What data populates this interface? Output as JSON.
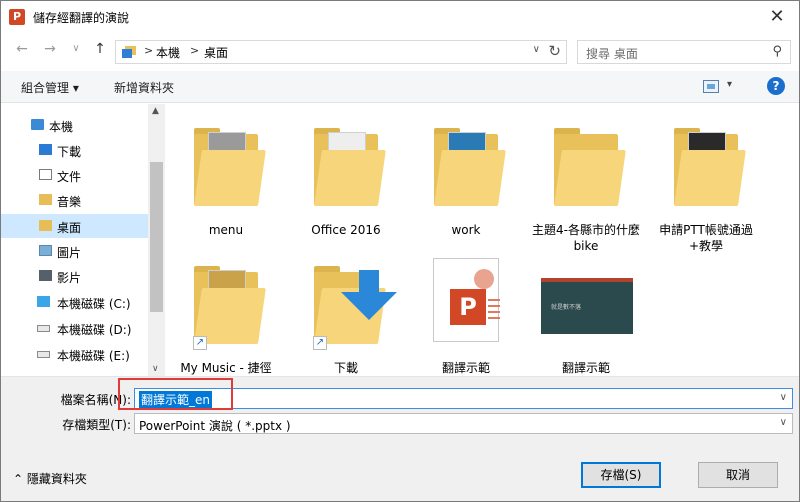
{
  "window": {
    "title": "儲存經翻譯的演說",
    "app_icon_letter": "P",
    "close_glyph": "✕"
  },
  "nav": {
    "back_glyph": "←",
    "forward_glyph": "→",
    "recent_glyph": "∨",
    "up_glyph": "↑",
    "breadcrumb": [
      "本機",
      "桌面"
    ],
    "crumb_sep": ">",
    "dropdown_glyph": "∨",
    "refresh_glyph": "↻",
    "search_placeholder": "搜尋 桌面",
    "search_glyph": "⚲"
  },
  "toolbar": {
    "organize_label": "組合管理 ▾",
    "new_folder_label": "新增資料夾",
    "view_dd_glyph": "▾",
    "help_glyph": "?"
  },
  "sidebar": {
    "items": [
      {
        "label": "本機",
        "icon": "computer-icon"
      },
      {
        "label": "下載",
        "icon": "downloads-icon"
      },
      {
        "label": "文件",
        "icon": "documents-icon"
      },
      {
        "label": "音樂",
        "icon": "music-icon"
      },
      {
        "label": "桌面",
        "icon": "desktop-icon",
        "selected": true
      },
      {
        "label": "圖片",
        "icon": "pictures-icon"
      },
      {
        "label": "影片",
        "icon": "videos-icon"
      },
      {
        "label": "本機磁碟 (C:)",
        "icon": "drive-icon"
      },
      {
        "label": "本機磁碟 (D:)",
        "icon": "drive-icon"
      },
      {
        "label": "本機磁碟 (E:)",
        "icon": "drive-icon"
      }
    ],
    "scroll_up_glyph": "▲",
    "scroll_down_glyph": "∨"
  },
  "files": [
    {
      "name": "menu",
      "type": "folder"
    },
    {
      "name": "Office 2016",
      "type": "folder"
    },
    {
      "name": "work",
      "type": "folder"
    },
    {
      "name": "主題4-各縣市的什麼bike",
      "type": "folder"
    },
    {
      "name": "申請PTT帳號通過+教學",
      "type": "folder"
    },
    {
      "name": "My Music - 捷徑",
      "type": "shortcut-folder"
    },
    {
      "name": "下載",
      "type": "shortcut-downloads"
    },
    {
      "name": "翻譯示範",
      "type": "pptx"
    },
    {
      "name": "翻譯示範",
      "type": "pptx-thumbnail"
    }
  ],
  "thumb_text": "就是數不落",
  "form": {
    "filename_label": "檔案名稱(N):",
    "filename_value": "翻譯示範_en",
    "filetype_label": "存檔類型(T):",
    "filetype_value": "PowerPoint 演說 ( *.pptx )",
    "dd_glyph": "∨"
  },
  "footer": {
    "hide_folders_label": "⌃  隱藏資料夾",
    "save_label": "存檔(S)",
    "cancel_label": "取消"
  },
  "colors": {
    "accent": "#0078d7",
    "highlight_box": "#e03a3a",
    "selected_bg": "#cde8ff"
  }
}
